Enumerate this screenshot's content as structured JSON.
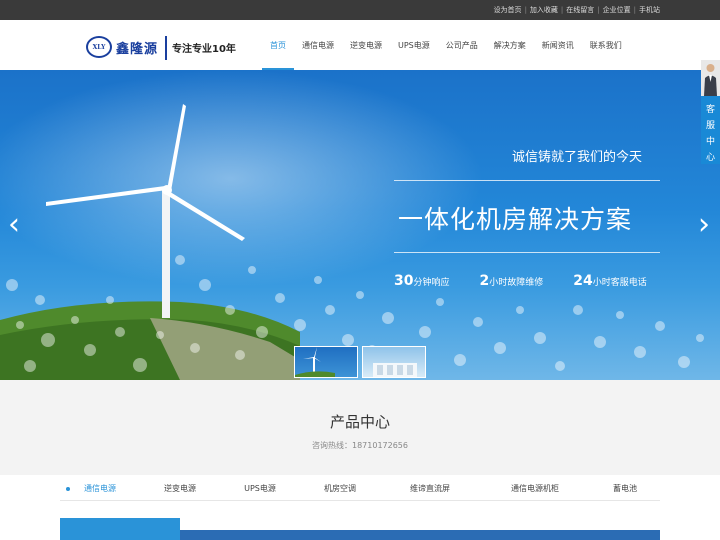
{
  "topbar": {
    "links": [
      "设为首页",
      "加入收藏",
      "在线留言",
      "企业位置",
      "手机站"
    ]
  },
  "header": {
    "logo_mark": "XLY",
    "logo_name": "鑫隆源",
    "slogan": "专注专业10年"
  },
  "nav": {
    "items": [
      "首页",
      "通信电源",
      "逆变电源",
      "UPS电源",
      "公司产品",
      "解决方案",
      "新闻资讯",
      "联系我们"
    ],
    "active_index": 0
  },
  "banner": {
    "tagline": "诚信铸就了我们的今天",
    "headline": "一体化机房解决方案",
    "stats": [
      {
        "num": "30",
        "text": "分钟响应"
      },
      {
        "num": "2",
        "text": "小时故障维修"
      },
      {
        "num": "24",
        "text": "小时客服电话"
      }
    ],
    "prev_icon": "‹",
    "next_icon": "›"
  },
  "side_service": {
    "label": [
      "客",
      "服",
      "中",
      "心"
    ]
  },
  "products": {
    "title": "产品中心",
    "hotline": "咨询热线：18710172656",
    "tabs": [
      "通信电源",
      "逆变电源",
      "UPS电源",
      "机房空调",
      "维谛直流屏",
      "通信电源机柜",
      "蓄电池"
    ],
    "active_tab": 0
  },
  "colors": {
    "accent": "#2a93d8",
    "brand": "#1a3f9e",
    "topbar": "#3a3a3a"
  }
}
